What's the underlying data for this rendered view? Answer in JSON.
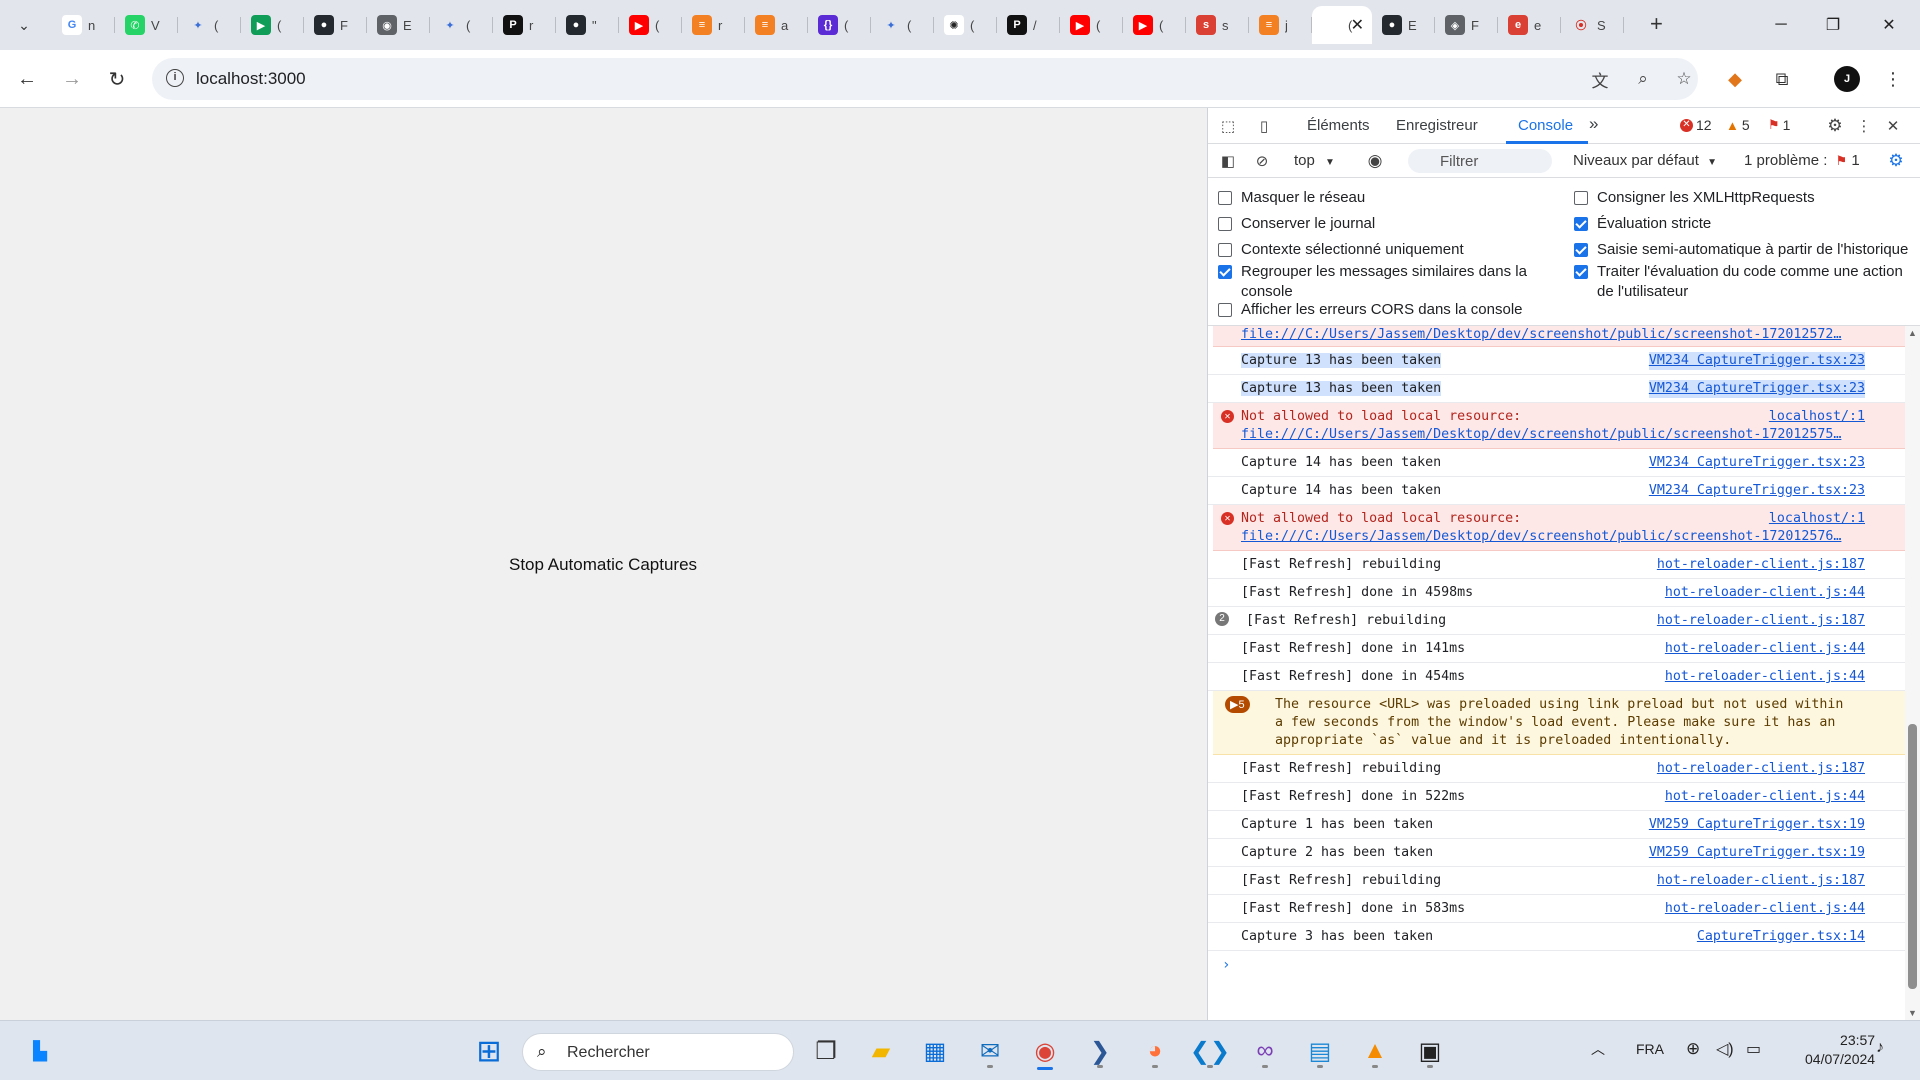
{
  "browser": {
    "tabs": [
      {
        "icon": "google-icon",
        "letter": "G",
        "color": "#ffffff",
        "fg": "#4285f4",
        "title": "n"
      },
      {
        "icon": "whatsapp-icon",
        "letter": "✆",
        "color": "#25d366",
        "fg": "#ffffff",
        "title": "V"
      },
      {
        "icon": "gemini-icon",
        "letter": "✦",
        "color": "transparent",
        "fg": "#3b6fd8",
        "title": "("
      },
      {
        "icon": "google-meet-icon",
        "letter": "▶",
        "color": "#0f9d58",
        "fg": "#ffffff",
        "title": "("
      },
      {
        "icon": "github-icon",
        "letter": "●",
        "color": "#24292f",
        "fg": "#ffffff",
        "title": "F"
      },
      {
        "icon": "globe-icon",
        "letter": "◉",
        "color": "#5f6368",
        "fg": "#ffffff",
        "title": "E"
      },
      {
        "icon": "gemini-icon",
        "letter": "✦",
        "color": "transparent",
        "fg": "#3b6fd8",
        "title": "("
      },
      {
        "icon": "perplexity-icon",
        "letter": "P",
        "color": "#111111",
        "fg": "#ffffff",
        "title": "r"
      },
      {
        "icon": "github-icon",
        "letter": "●",
        "color": "#24292f",
        "fg": "#ffffff",
        "title": "\""
      },
      {
        "icon": "youtube-icon",
        "letter": "▶",
        "color": "#ff0000",
        "fg": "#ffffff",
        "title": "("
      },
      {
        "icon": "stackoverflow-icon",
        "letter": "≡",
        "color": "#f48024",
        "fg": "#ffffff",
        "title": "r"
      },
      {
        "icon": "stackoverflow-icon",
        "letter": "≡",
        "color": "#f48024",
        "fg": "#ffffff",
        "title": "a"
      },
      {
        "icon": "curly-braces-icon",
        "letter": "{}",
        "color": "#5b2bd6",
        "fg": "#ffffff",
        "title": "("
      },
      {
        "icon": "gemini-icon",
        "letter": "✦",
        "color": "transparent",
        "fg": "#3b6fd8",
        "title": "("
      },
      {
        "icon": "openai-icon",
        "letter": "✺",
        "color": "#ffffff",
        "fg": "#222222",
        "title": "("
      },
      {
        "icon": "perplexity-icon",
        "letter": "P",
        "color": "#111111",
        "fg": "#ffffff",
        "title": "/"
      },
      {
        "icon": "youtube-icon",
        "letter": "▶",
        "color": "#ff0000",
        "fg": "#ffffff",
        "title": "("
      },
      {
        "icon": "youtube-icon",
        "letter": "▶",
        "color": "#ff0000",
        "fg": "#ffffff",
        "title": "("
      },
      {
        "icon": "todoist-icon",
        "letter": "s",
        "color": "#db4035",
        "fg": "#ffffff",
        "title": "s"
      },
      {
        "icon": "stackoverflow-icon",
        "letter": "≡",
        "color": "#f48024",
        "fg": "#ffffff",
        "title": "j"
      },
      {
        "icon": "blank-page-icon",
        "letter": "",
        "color": "transparent",
        "fg": "#555555",
        "title": "(",
        "active": true
      },
      {
        "icon": "github-icon",
        "letter": "●",
        "color": "#24292f",
        "fg": "#ffffff",
        "title": "E"
      },
      {
        "icon": "compass-icon",
        "letter": "◈",
        "color": "#5f6368",
        "fg": "#ffffff",
        "title": "F"
      },
      {
        "icon": "todoist-icon",
        "letter": "e",
        "color": "#db4035",
        "fg": "#ffffff",
        "title": "e"
      },
      {
        "icon": "record-icon",
        "letter": "⦿",
        "color": "transparent",
        "fg": "#d93025",
        "title": "S"
      }
    ],
    "active_close": "✕",
    "new_tab": "+",
    "url": "localhost:3000"
  },
  "page": {
    "stop_button": "Stop Automatic Captures"
  },
  "devtools": {
    "tabs": {
      "elements": "Éléments",
      "recorder": "Enregistreur",
      "console": "Console",
      "more": "»"
    },
    "counts": {
      "errors": "12",
      "warnings": "5",
      "issues": "1"
    },
    "context": "top",
    "filter_placeholder": "Filtrer",
    "levels": "Niveaux par défaut",
    "issues_label": "1 problème :",
    "issues_count": "1",
    "settings_left": [
      {
        "label": "Masquer le réseau",
        "checked": false
      },
      {
        "label": "Conserver le journal",
        "checked": false
      },
      {
        "label": "Contexte sélectionné uniquement",
        "checked": false
      },
      {
        "label": "Regrouper les messages similaires dans la console",
        "checked": true
      },
      {
        "label": "Afficher les erreurs CORS dans la console",
        "checked": false
      }
    ],
    "settings_right": [
      {
        "label": "Consigner les XMLHttpRequests",
        "checked": false
      },
      {
        "label": "Évaluation stricte",
        "checked": true
      },
      {
        "label": "Saisie semi-automatique à partir de l'historique",
        "checked": true
      },
      {
        "label": "Traiter l'évaluation du code comme une action de l'utilisateur",
        "checked": true
      }
    ],
    "console": [
      {
        "type": "error-tail",
        "link": "file:///C:/Users/Jassem/Desktop/dev/screenshot/public/screenshot-172012572…"
      },
      {
        "type": "log",
        "selected": true,
        "msg": "Capture 13 has been taken",
        "src": "VM234 CaptureTrigger.tsx:23"
      },
      {
        "type": "log",
        "selected": true,
        "msg": "Capture 13 has been taken",
        "src": "VM234 CaptureTrigger.tsx:23"
      },
      {
        "type": "error",
        "msg": "Not allowed to load local resource:",
        "link": "file:///C:/Users/Jassem/Desktop/dev/screenshot/public/screenshot-172012575…",
        "src": "localhost/:1"
      },
      {
        "type": "log",
        "msg": "Capture 14 has been taken",
        "src": "VM234 CaptureTrigger.tsx:23"
      },
      {
        "type": "log",
        "msg": "Capture 14 has been taken",
        "src": "VM234 CaptureTrigger.tsx:23"
      },
      {
        "type": "error",
        "msg": "Not allowed to load local resource:",
        "link": "file:///C:/Users/Jassem/Desktop/dev/screenshot/public/screenshot-172012576…",
        "src": "localhost/:1"
      },
      {
        "type": "log",
        "msg": "[Fast Refresh] rebuilding",
        "src": "hot-reloader-client.js:187"
      },
      {
        "type": "log",
        "msg": "[Fast Refresh] done in 4598ms",
        "src": "hot-reloader-client.js:44"
      },
      {
        "type": "log",
        "count": "2",
        "msg": "[Fast Refresh] rebuilding",
        "src": "hot-reloader-client.js:187"
      },
      {
        "type": "log",
        "msg": "[Fast Refresh] done in 141ms",
        "src": "hot-reloader-client.js:44"
      },
      {
        "type": "log",
        "msg": "[Fast Refresh] done in 454ms",
        "src": "hot-reloader-client.js:44"
      },
      {
        "type": "warn",
        "count": "5",
        "msg": "The resource <URL> was preloaded using link preload but not used within\na few seconds from the window's load event. Please make sure it has an\nappropriate `as` value and it is preloaded intentionally."
      },
      {
        "type": "log",
        "msg": "[Fast Refresh] rebuilding",
        "src": "hot-reloader-client.js:187"
      },
      {
        "type": "log",
        "msg": "[Fast Refresh] done in 522ms",
        "src": "hot-reloader-client.js:44"
      },
      {
        "type": "log",
        "msg": "Capture 1 has been taken",
        "src": "VM259 CaptureTrigger.tsx:19"
      },
      {
        "type": "log",
        "msg": "Capture 2 has been taken",
        "src": "VM259 CaptureTrigger.tsx:19"
      },
      {
        "type": "log",
        "msg": "[Fast Refresh] rebuilding",
        "src": "hot-reloader-client.js:187"
      },
      {
        "type": "log",
        "msg": "[Fast Refresh] done in 583ms",
        "src": "hot-reloader-client.js:44"
      },
      {
        "type": "log",
        "msg": "Capture 3 has been taken",
        "src": "CaptureTrigger.tsx:14"
      }
    ]
  },
  "taskbar": {
    "search_placeholder": "Rechercher",
    "language": "FRA",
    "time": "23:57",
    "date": "04/07/2024",
    "apps": [
      {
        "name": "windows-start-icon",
        "glyph": "⊞",
        "color": "#0a6cd6"
      },
      {
        "name": "task-view-icon",
        "glyph": "❐",
        "color": "#333333"
      },
      {
        "name": "file-explorer-icon",
        "glyph": "▰",
        "color": "#f2b600"
      },
      {
        "name": "microsoft-store-icon",
        "glyph": "▦",
        "color": "#0a6cd6"
      },
      {
        "name": "outlook-icon",
        "glyph": "✉",
        "color": "#0f6cbd"
      },
      {
        "name": "chrome-icon",
        "glyph": "◉",
        "color": "#db4437"
      },
      {
        "name": "powershell-icon",
        "glyph": "❯",
        "color": "#2b5797"
      },
      {
        "name": "firefox-icon",
        "glyph": "◕",
        "color": "#ff7139"
      },
      {
        "name": "vscode-icon",
        "glyph": "❮❯",
        "color": "#0a7acc"
      },
      {
        "name": "visual-studio-icon",
        "glyph": "∞",
        "color": "#7b3fb5"
      },
      {
        "name": "notepad-icon",
        "glyph": "▤",
        "color": "#1a88d6"
      },
      {
        "name": "vlc-icon",
        "glyph": "▲",
        "color": "#f48b00"
      },
      {
        "name": "terminal-icon",
        "glyph": "▣",
        "color": "#222222"
      }
    ]
  }
}
